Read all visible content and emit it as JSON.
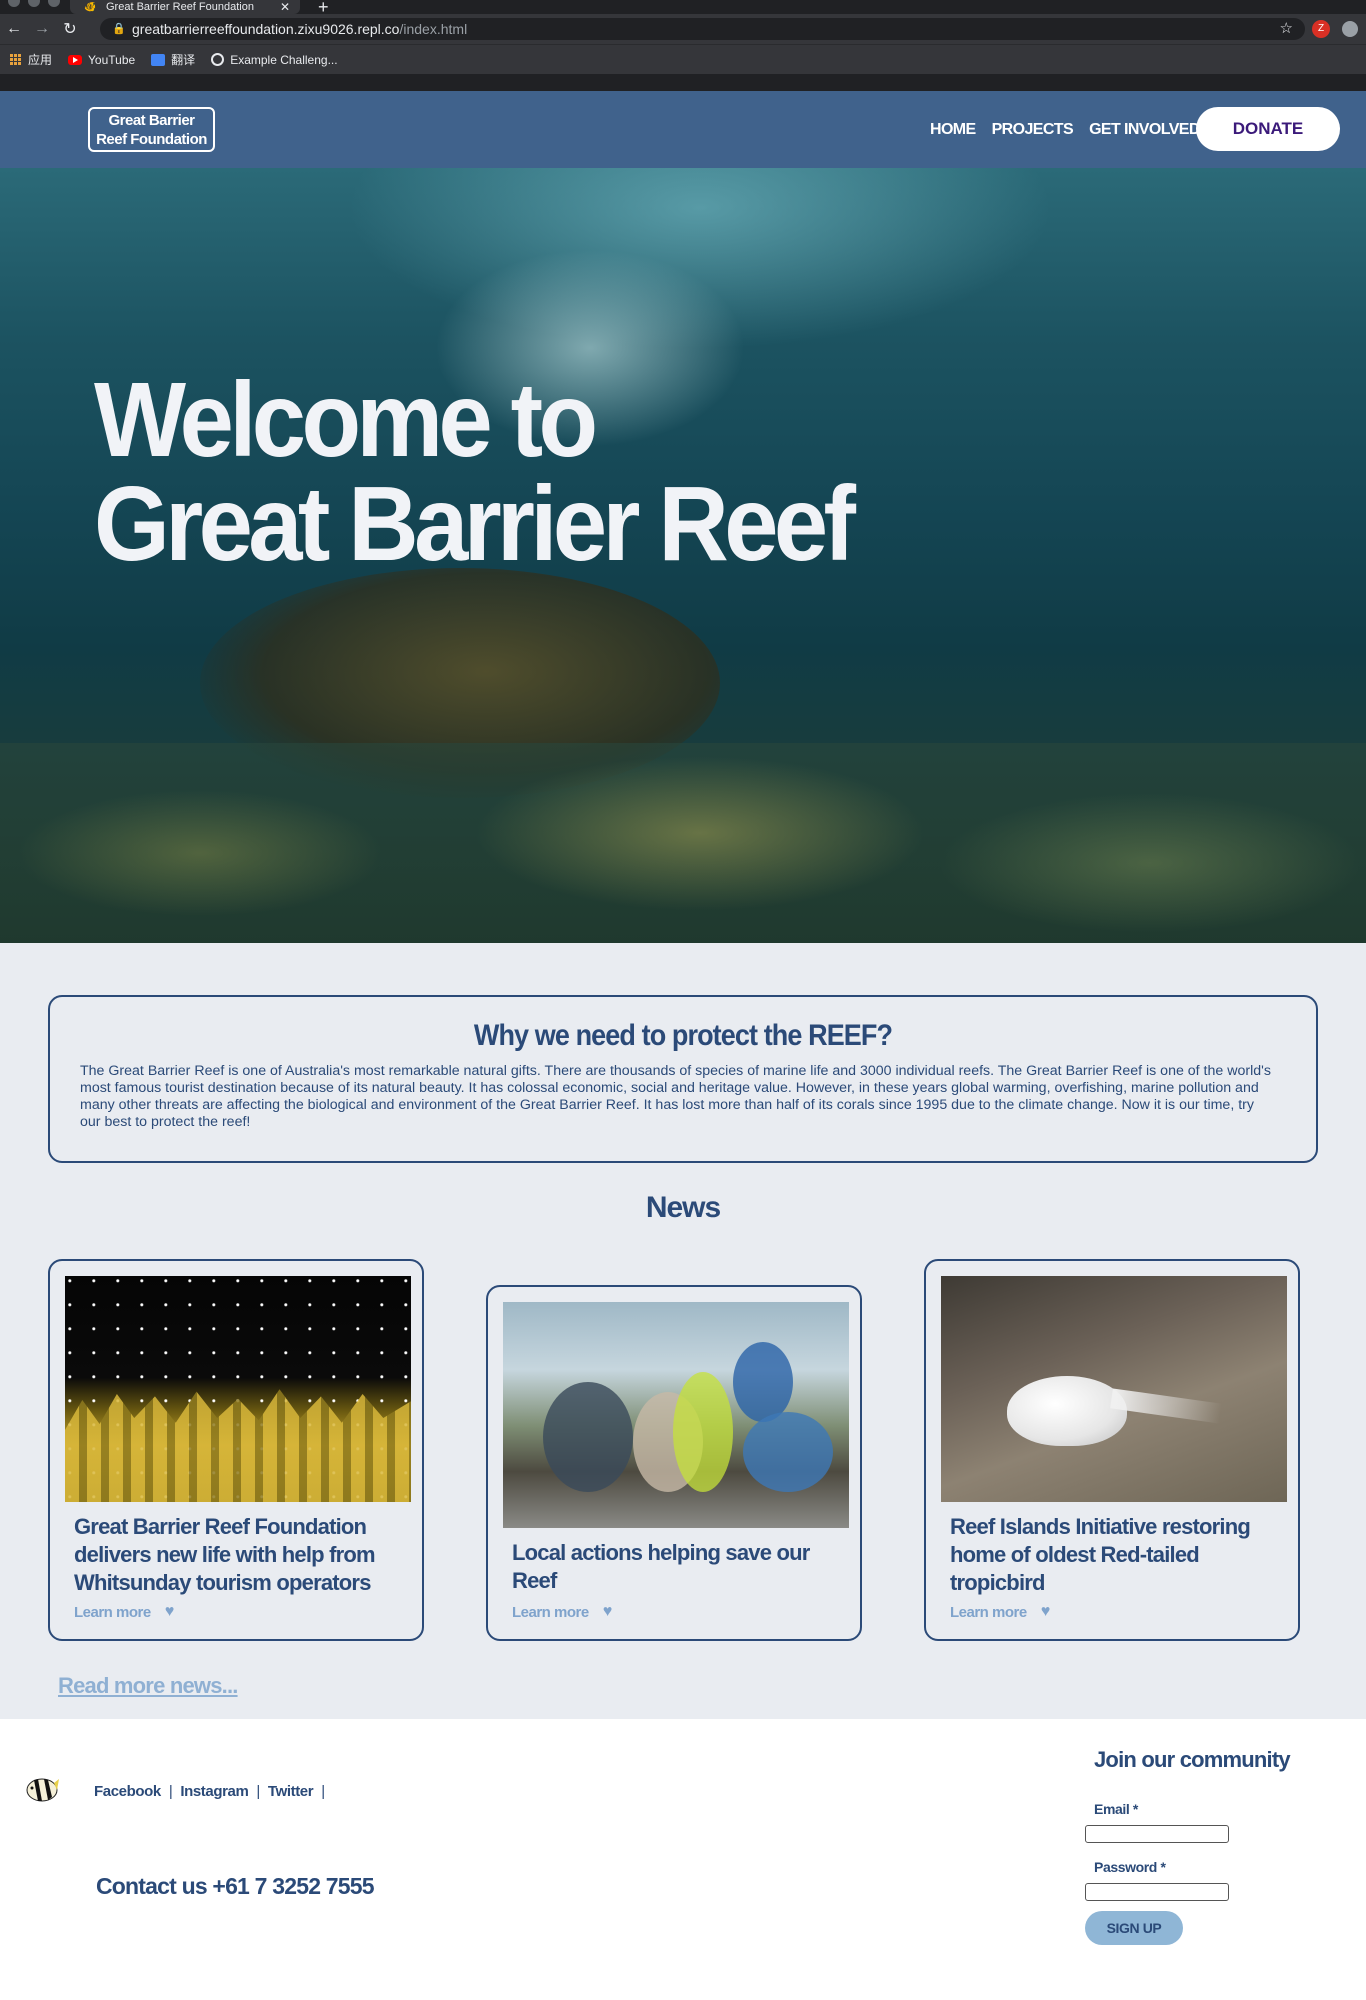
{
  "browser": {
    "tab_title": "Great Barrier Reef Foundation",
    "url_host": "greatbarrierreeffoundation.zixu9026.repl.co",
    "url_path": "/index.html",
    "profile_initial": "Z",
    "bookmarks": [
      {
        "label": "应用",
        "icon": "apps-grid-icon"
      },
      {
        "label": "YouTube",
        "icon": "youtube-icon"
      },
      {
        "label": "翻译",
        "icon": "translate-icon"
      },
      {
        "label": "Example Challeng...",
        "icon": "globe-icon"
      }
    ]
  },
  "header": {
    "logo_line1": "Great Barrier",
    "logo_line2": "Reef Foundation",
    "nav": [
      "HOME",
      "PROJECTS",
      "GET INVOLVED"
    ],
    "donate": "DONATE"
  },
  "hero": {
    "line1": "Welcome to",
    "line2": "Great Barrier Reef"
  },
  "why": {
    "title": "Why we need to protect the REEF?",
    "body": "The Great Barrier Reef is one of Australia's most remarkable natural gifts. There are thousands of species of marine life and 3000 individual reefs. The Great Barrier Reef is one of the world's most famous tourist destination because of its natural beauty. It has colossal economic, social and heritage value. However, in these years global warming, overfishing, marine pollution and many other threats are affecting the biological and environment of the Great Barrier Reef. It has lost more than half of its corals since 1995 due to the climate change. Now it is our time, try our best to protect the reef!"
  },
  "news": {
    "title": "News",
    "cards": [
      {
        "title": "Great Barrier Reef Foundation delivers new life with help from Whitsunday tourism operators",
        "learn": "Learn more"
      },
      {
        "title": "Local actions helping save our Reef",
        "learn": "Learn more"
      },
      {
        "title": "Reef Islands Initiative restoring home of oldest Red-tailed tropicbird",
        "learn": "Learn more"
      }
    ],
    "read_more": "Read more news..."
  },
  "footer": {
    "social": [
      "Facebook",
      "Instagram",
      "Twitter"
    ],
    "contact": "Contact us +61 7 3252 7555",
    "join_title": "Join our community",
    "email_label": "Email",
    "password_label": "Password",
    "required_mark": "*",
    "signup": "SIGN UP"
  },
  "colors": {
    "header_bg": "#40628c",
    "primary_text": "#2b4a78",
    "accent_light": "#7fa3cc",
    "donate_text": "#3b1a7a"
  }
}
